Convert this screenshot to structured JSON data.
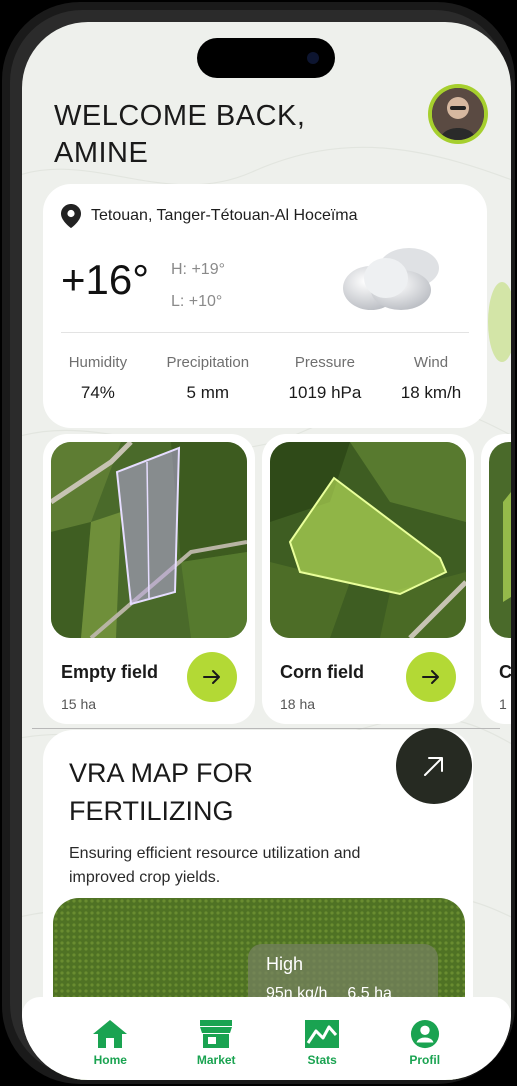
{
  "header": {
    "welcome_line1": "WELCOME BACK,",
    "welcome_line2": "AMINE"
  },
  "weather": {
    "location": "Tetouan, Tanger-Tétouan-Al Hoceïma",
    "temperature": "+16°",
    "high": "H: +19°",
    "low": "L: +10°",
    "condition_icon": "cloud-icon",
    "stats": [
      {
        "label": "Humidity",
        "value": "74%"
      },
      {
        "label": "Precipitation",
        "value": "5 mm"
      },
      {
        "label": "Pressure",
        "value": "1019 hPa"
      },
      {
        "label": "Wind",
        "value": "18 km/h"
      }
    ]
  },
  "fields": [
    {
      "name": "Empty field",
      "size": "15 ha"
    },
    {
      "name": "Corn field",
      "size": "18 ha"
    },
    {
      "name": "C",
      "size": "1"
    }
  ],
  "vra": {
    "title_line1": "VRA MAP FOR",
    "title_line2": "FERTILIZING",
    "description": "Ensuring efficient resource utilization and improved crop yields.",
    "overlay_label": "High",
    "overlay_rate": "95n kg/h",
    "overlay_area": "6,5 ha"
  },
  "tabbar": [
    {
      "label": "Home",
      "icon": "home-icon"
    },
    {
      "label": "Market",
      "icon": "market-icon"
    },
    {
      "label": "Stats",
      "icon": "stats-icon"
    },
    {
      "label": "Profil",
      "icon": "profile-icon"
    }
  ],
  "colors": {
    "accent": "#b3d935",
    "nav_green": "#1aa351",
    "fab_dark": "#262a22"
  }
}
